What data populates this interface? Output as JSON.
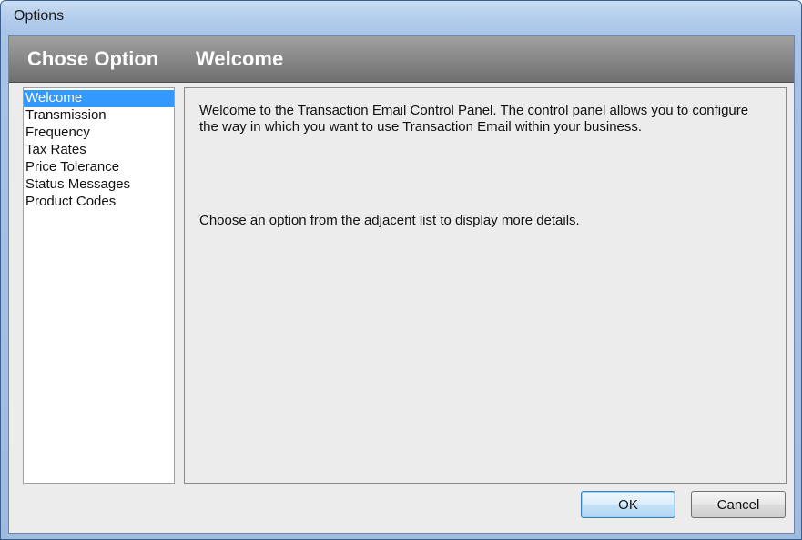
{
  "window": {
    "title": "Options"
  },
  "header": {
    "title": "Chose Option",
    "subtitle": "Welcome"
  },
  "option_list": {
    "items": [
      {
        "label": "Welcome",
        "selected": true
      },
      {
        "label": "Transmission",
        "selected": false
      },
      {
        "label": "Frequency",
        "selected": false
      },
      {
        "label": "Tax Rates",
        "selected": false
      },
      {
        "label": "Price Tolerance",
        "selected": false
      },
      {
        "label": "Status Messages",
        "selected": false
      },
      {
        "label": "Product Codes",
        "selected": false
      }
    ]
  },
  "content": {
    "welcome_text": "Welcome to the Transaction Email Control Panel. The control panel allows you to configure the way in which you want to use Transaction Email within your business.",
    "instruction_text": "Choose an option from the adjacent list to display more details."
  },
  "buttons": {
    "ok_label": "OK",
    "cancel_label": "Cancel"
  },
  "colors": {
    "selection": "#3399ff",
    "header_band": "#8a8a8a",
    "title_bar": "#b3cdec"
  }
}
